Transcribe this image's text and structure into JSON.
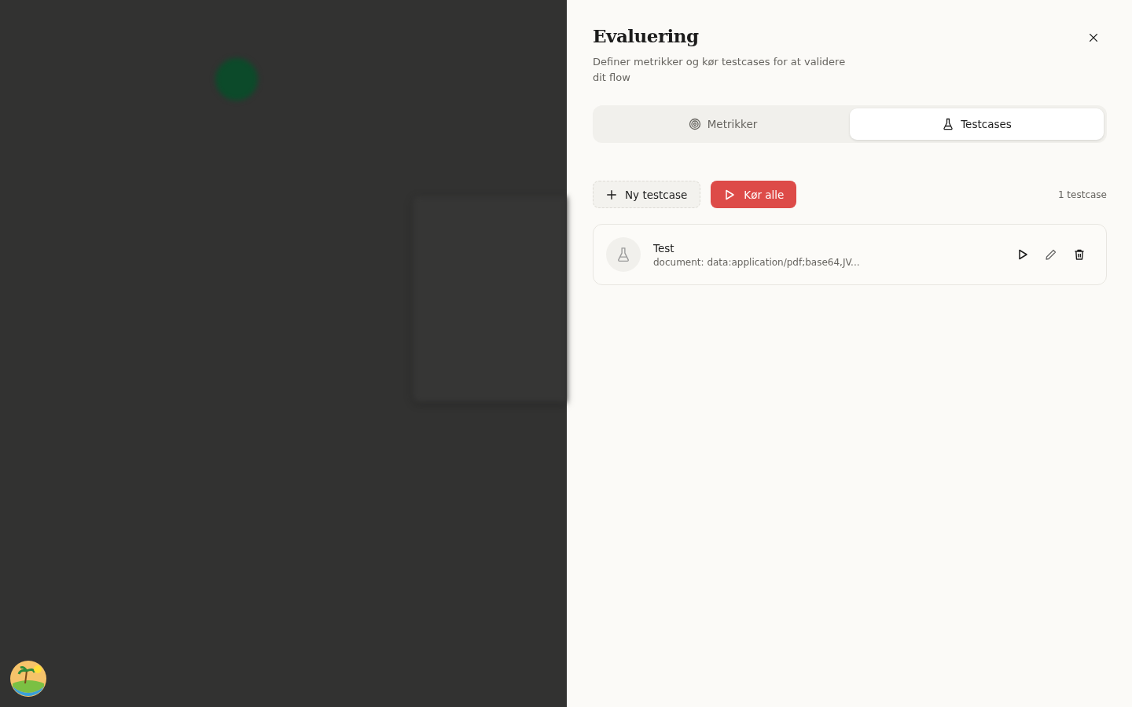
{
  "panel": {
    "title": "Evaluering",
    "subtitle": "Definer metrikker og kør testcases for at validere dit flow"
  },
  "tabs": [
    {
      "label": "Metrikker",
      "kind": "target",
      "selected": false
    },
    {
      "label": "Testcases",
      "kind": "flask",
      "selected": true
    }
  ],
  "toolbar": {
    "buttons": [
      {
        "label": "Ny testcase",
        "kind": "add"
      },
      {
        "label": "Kør alle",
        "kind": "run"
      }
    ],
    "count": "1 testcase"
  },
  "testcases": [
    {
      "name": "Test",
      "detail": "document: data:application/pdf;base64,JV..."
    }
  ]
}
